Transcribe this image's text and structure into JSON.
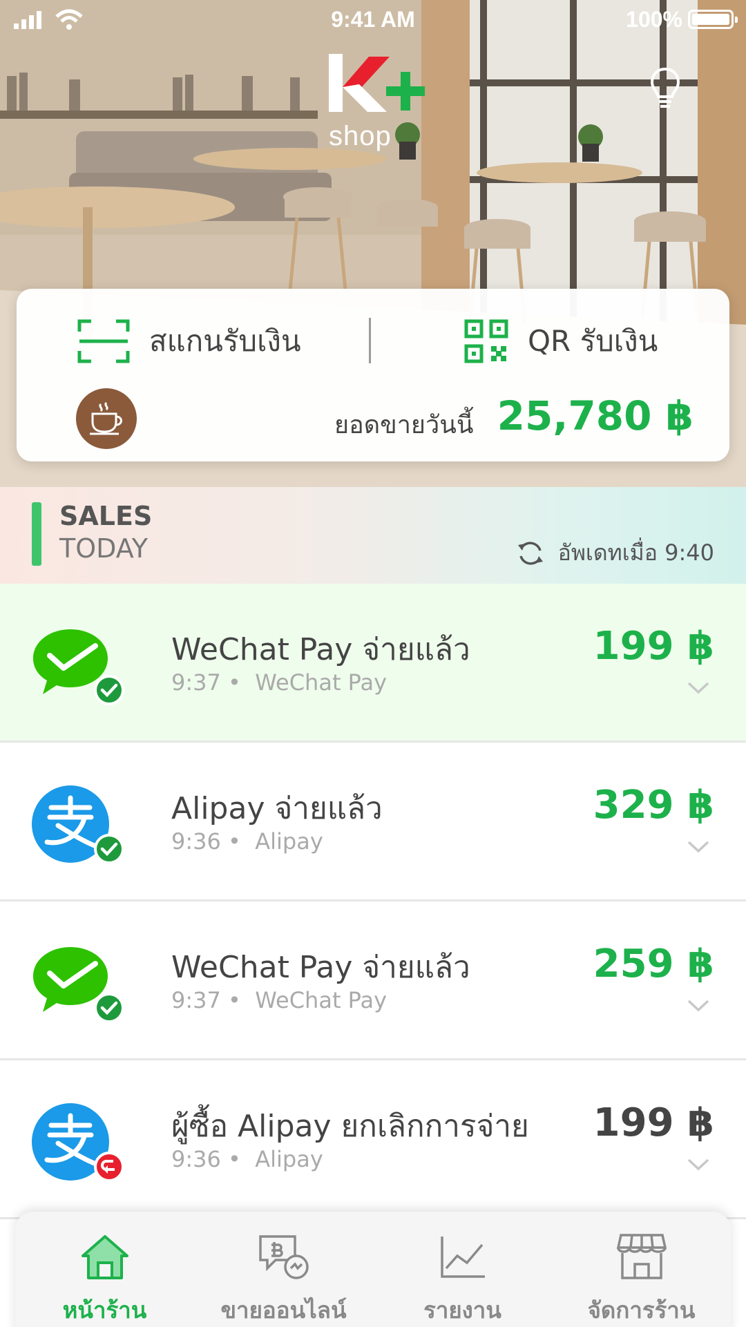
{
  "status_bar": {
    "time": "9:41 AM",
    "battery": "100%"
  },
  "brand": {
    "logo_text": "shop"
  },
  "actions": {
    "scan_label": "สแกนรับเงิน",
    "qr_label": "QR รับเงิน",
    "today_sales_label": "ยอดขายวันนี้",
    "today_sales_amount": "25,780 ฿"
  },
  "sales_section": {
    "title_line1": "SALES",
    "title_line2": "TODAY",
    "updated_text": "อัพเดทเมื่อ 9:40"
  },
  "transactions": [
    {
      "title": "WeChat Pay จ่ายแล้ว",
      "time": "9:37 •",
      "method": "WeChat Pay",
      "amount": "199 ฿",
      "icon": "wechat-pay-icon",
      "status": "paid"
    },
    {
      "title": "Alipay จ่ายแล้ว",
      "time": "9:36 •",
      "method": "Alipay",
      "amount": "329 ฿",
      "icon": "alipay-icon",
      "status": "paid"
    },
    {
      "title": "WeChat Pay จ่ายแล้ว",
      "time": "9:37 •",
      "method": "WeChat Pay",
      "amount": "259 ฿",
      "icon": "wechat-pay-icon",
      "status": "paid"
    },
    {
      "title": "ผู้ซื้อ Alipay ยกเลิกการจ่าย",
      "time": "9:36 •",
      "method": "Alipay",
      "amount": "199 ฿",
      "icon": "alipay-icon",
      "status": "cancelled"
    }
  ],
  "nav": [
    {
      "label": "หน้าร้าน",
      "icon": "home-icon",
      "active": true
    },
    {
      "label": "ขายออนไลน์",
      "icon": "online-sales-icon",
      "active": false
    },
    {
      "label": "รายงาน",
      "icon": "report-chart-icon",
      "active": false
    },
    {
      "label": "จัดการร้าน",
      "icon": "store-manage-icon",
      "active": false
    }
  ],
  "colors": {
    "accent_green": "#1db14b",
    "wechat_green": "#2dc100",
    "alipay_blue": "#1a9ae8",
    "cancel_red": "#e8202e",
    "highlight_bg": "#effdec"
  }
}
